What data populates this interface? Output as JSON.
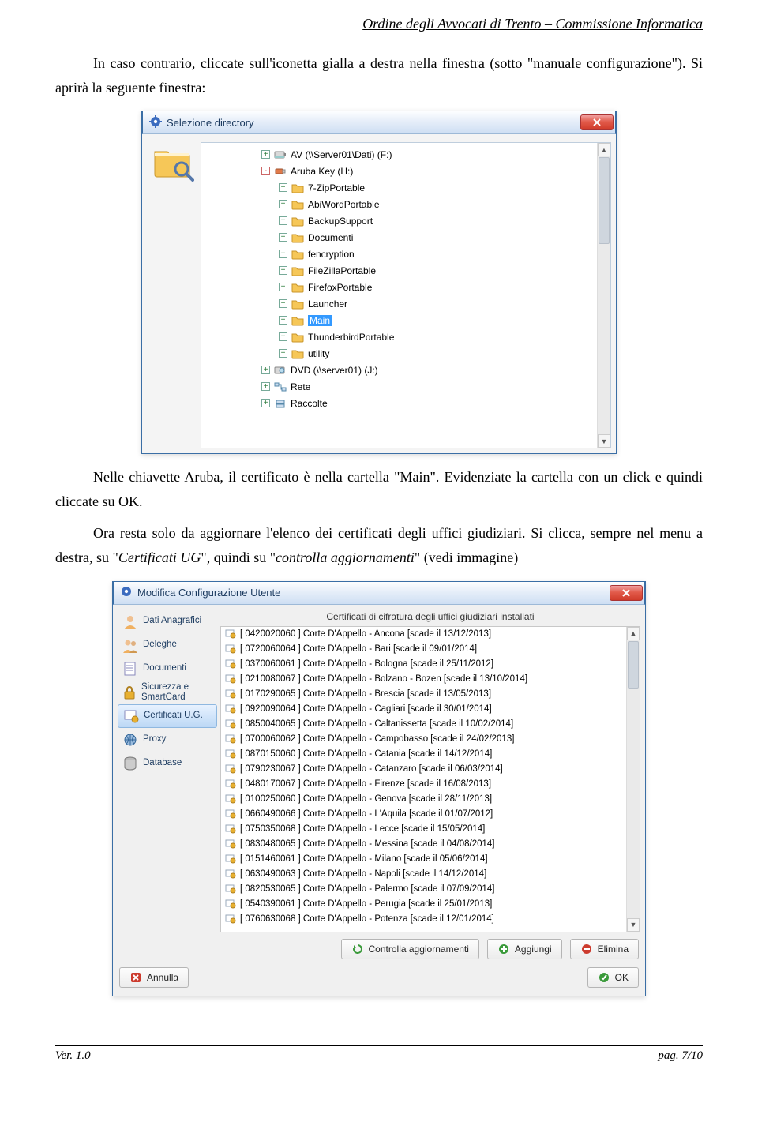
{
  "header": "Ordine degli Avvocati di Trento – Commissione Informatica",
  "para1_a": "In caso contrario, cliccate sull'iconetta gialla a destra nella finestra (sotto \"manuale configurazione\"). Si aprirà la seguente finestra:",
  "para2": "Nelle chiavette Aruba, il certificato è nella cartella \"Main\". Evidenziate la cartella con un click e quindi cliccate su OK.",
  "para3_a": "Ora resta solo da aggiornare l'elenco dei certificati degli uffici giudiziari. Si clicca, sempre nel menu a destra, su \"",
  "para3_i": "Certificati UG",
  "para3_b": "\", quindi su \"",
  "para3_i2": "controlla aggiornamenti",
  "para3_c": "\" (vedi immagine)",
  "dlg1": {
    "title": "Selezione directory",
    "items": [
      {
        "indent": 70,
        "exp": "+",
        "icon": "drive",
        "label": "AV (\\\\Server01\\Dati) (F:)"
      },
      {
        "indent": 70,
        "exp": "-",
        "icon": "usb",
        "label": "Aruba Key (H:)"
      },
      {
        "indent": 92,
        "exp": "+",
        "icon": "folder",
        "label": "7-ZipPortable"
      },
      {
        "indent": 92,
        "exp": "+",
        "icon": "folder",
        "label": "AbiWordPortable"
      },
      {
        "indent": 92,
        "exp": "+",
        "icon": "folder",
        "label": "BackupSupport"
      },
      {
        "indent": 92,
        "exp": "+",
        "icon": "folder",
        "label": "Documenti"
      },
      {
        "indent": 92,
        "exp": "+",
        "icon": "folder",
        "label": "fencryption"
      },
      {
        "indent": 92,
        "exp": "+",
        "icon": "folder",
        "label": "FileZillaPortable"
      },
      {
        "indent": 92,
        "exp": "+",
        "icon": "folder",
        "label": "FirefoxPortable"
      },
      {
        "indent": 92,
        "exp": "+",
        "icon": "folder",
        "label": "Launcher"
      },
      {
        "indent": 92,
        "exp": "+",
        "icon": "folder",
        "label": "Main",
        "sel": true
      },
      {
        "indent": 92,
        "exp": "+",
        "icon": "folder",
        "label": "ThunderbirdPortable"
      },
      {
        "indent": 92,
        "exp": "+",
        "icon": "folder",
        "label": "utility"
      },
      {
        "indent": 70,
        "exp": "+",
        "icon": "dvd",
        "label": "DVD (\\\\server01) (J:)"
      },
      {
        "indent": 70,
        "exp": "+",
        "icon": "net",
        "label": "Rete"
      },
      {
        "indent": 70,
        "exp": "+",
        "icon": "bin",
        "label": "Raccolte"
      }
    ]
  },
  "dlg2": {
    "title": "Modifica Configurazione Utente",
    "listTitle": "Certificati di cifratura degli uffici giudiziari installati",
    "sidebar": [
      {
        "label": "Dati Anagrafici",
        "icon": "user"
      },
      {
        "label": "Deleghe",
        "icon": "users"
      },
      {
        "label": "Documenti",
        "icon": "doc"
      },
      {
        "label": "Sicurezza e SmartCard",
        "icon": "lock"
      },
      {
        "label": "Certificati U.G.",
        "icon": "cert",
        "sel": true
      },
      {
        "label": "Proxy",
        "icon": "proxy"
      },
      {
        "label": "Database",
        "icon": "db"
      }
    ],
    "certs": [
      "[ 0420020060 ] Corte D'Appello - Ancona [scade il 13/12/2013]",
      "[ 0720060064 ] Corte D'Appello - Bari [scade il 09/01/2014]",
      "[ 0370060061 ] Corte D'Appello - Bologna [scade il 25/11/2012]",
      "[ 0210080067 ] Corte D'Appello - Bolzano - Bozen [scade il 13/10/2014]",
      "[ 0170290065 ] Corte D'Appello - Brescia [scade il 13/05/2013]",
      "[ 0920090064 ] Corte D'Appello - Cagliari [scade il 30/01/2014]",
      "[ 0850040065 ] Corte D'Appello - Caltanissetta [scade il 10/02/2014]",
      "[ 0700060062 ] Corte D'Appello - Campobasso [scade il 24/02/2013]",
      "[ 0870150060 ] Corte D'Appello - Catania [scade il 14/12/2014]",
      "[ 0790230067 ] Corte D'Appello - Catanzaro [scade il 06/03/2014]",
      "[ 0480170067 ] Corte D'Appello - Firenze [scade il 16/08/2013]",
      "[ 0100250060 ] Corte D'Appello - Genova [scade il 28/11/2013]",
      "[ 0660490066 ] Corte D'Appello - L'Aquila [scade il 01/07/2012]",
      "[ 0750350068 ] Corte D'Appello - Lecce [scade il 15/05/2014]",
      "[ 0830480065 ] Corte D'Appello - Messina [scade il 04/08/2014]",
      "[ 0151460061 ] Corte D'Appello - Milano [scade il 05/06/2014]",
      "[ 0630490063 ] Corte D'Appello - Napoli [scade il 14/12/2014]",
      "[ 0820530065 ] Corte D'Appello - Palermo [scade il 07/09/2014]",
      "[ 0540390061 ] Corte D'Appello - Perugia [scade il 25/01/2013]",
      "[ 0760630068 ] Corte D'Appello - Potenza [scade il 12/01/2014]"
    ],
    "btnControlla": "Controlla aggiornamenti",
    "btnAggiungi": "Aggiungi",
    "btnElimina": "Elimina",
    "btnAnnulla": "Annulla",
    "btnOK": "OK"
  },
  "footer": {
    "left": "Ver. 1.0",
    "right": "pag. 7/10"
  }
}
